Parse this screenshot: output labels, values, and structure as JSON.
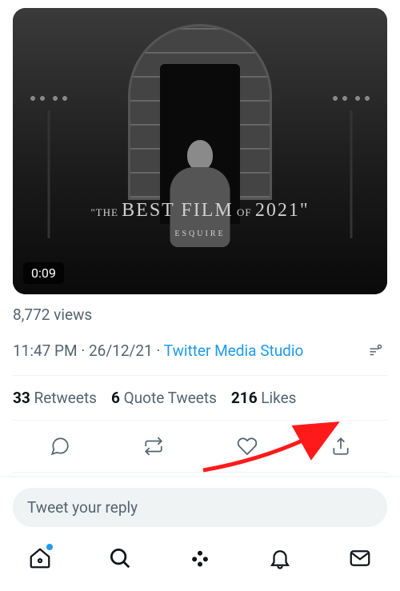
{
  "video": {
    "duration": "0:09",
    "quote_prefix": "\"THE",
    "quote_main": "BEST FILM",
    "quote_of": "OF",
    "quote_year": "2021\"",
    "quote_source": "ESQUIRE"
  },
  "views": "8,772 views",
  "timestamp": {
    "time": "11:47 PM",
    "sep1": " · ",
    "date": "26/12/21",
    "sep2": " · ",
    "source": "Twitter Media Studio"
  },
  "stats": {
    "retweets_count": "33",
    "retweets_label": " Retweets",
    "quotes_count": "6",
    "quotes_label": " Quote Tweets",
    "likes_count": "216",
    "likes_label": " Likes"
  },
  "reply": {
    "placeholder": "Tweet your reply"
  }
}
